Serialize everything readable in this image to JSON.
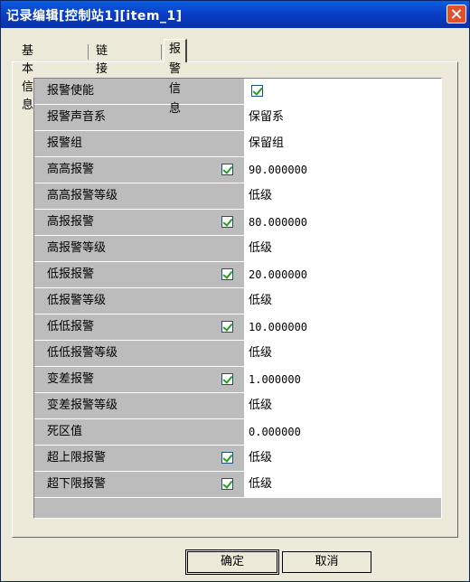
{
  "window": {
    "title": "记录编辑[控制站1][item_1]"
  },
  "tabs": [
    {
      "label": "基本信息"
    },
    {
      "label": "链接信息"
    },
    {
      "label": "报警信息"
    }
  ],
  "rows": [
    {
      "label": "报警使能",
      "checked": null,
      "value": "",
      "value_checked": true
    },
    {
      "label": "报警声音系",
      "checked": null,
      "value": "保留系"
    },
    {
      "label": "报警组",
      "checked": null,
      "value": "保留组"
    },
    {
      "label": "高高报警",
      "checked": true,
      "value": "90.000000"
    },
    {
      "label": "高高报警等级",
      "checked": null,
      "value": "低级"
    },
    {
      "label": "高报报警",
      "checked": true,
      "value": "80.000000"
    },
    {
      "label": "高报警等级",
      "checked": null,
      "value": "低级"
    },
    {
      "label": "低报报警",
      "checked": true,
      "value": "20.000000"
    },
    {
      "label": "低报警等级",
      "checked": null,
      "value": "低级"
    },
    {
      "label": "低低报警",
      "checked": true,
      "value": "10.000000"
    },
    {
      "label": "低低报警等级",
      "checked": null,
      "value": "低级"
    },
    {
      "label": "变差报警",
      "checked": true,
      "value": "1.000000"
    },
    {
      "label": "变差报警等级",
      "checked": null,
      "value": "低级"
    },
    {
      "label": "死区值",
      "checked": null,
      "value": "0.000000"
    },
    {
      "label": "超上限报警",
      "checked": true,
      "value": "低级"
    },
    {
      "label": "超下限报警",
      "checked": true,
      "value": "低级"
    }
  ],
  "buttons": {
    "ok": "确定",
    "cancel": "取消"
  },
  "colors": {
    "titlebar": "#0a3fc8",
    "close": "#e0502a",
    "grid": "#bcbcbc",
    "check": "#21a121"
  }
}
